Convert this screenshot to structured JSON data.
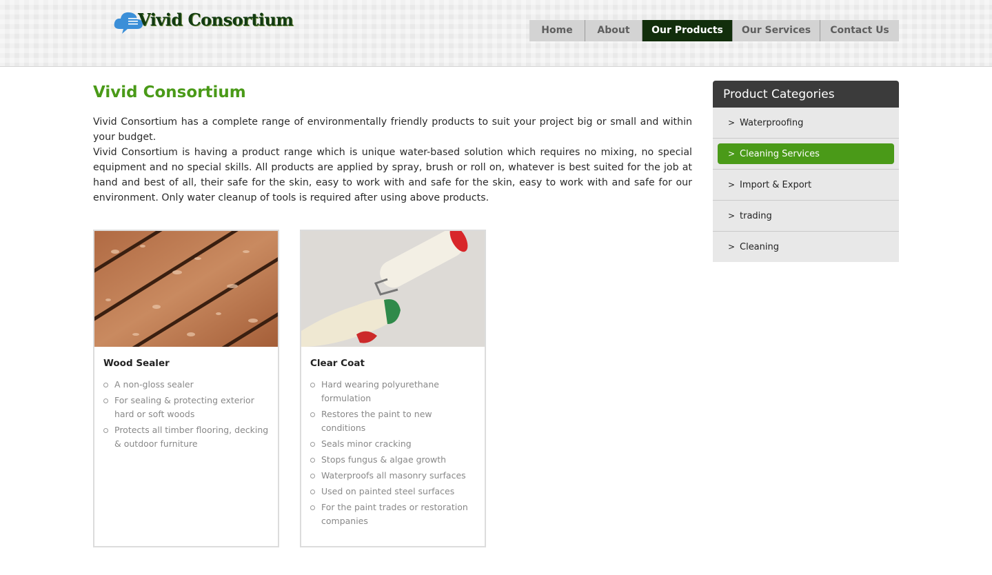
{
  "brand": {
    "name": "Vivid Consortium"
  },
  "nav": {
    "items": [
      {
        "label": "Home",
        "active": false
      },
      {
        "label": "About",
        "active": false
      },
      {
        "label": "Our Products",
        "active": true
      },
      {
        "label": "Our Services",
        "active": false
      },
      {
        "label": "Contact Us",
        "active": false
      }
    ]
  },
  "main": {
    "title": "Vivid Consortium",
    "intro_1": "Vivid Consortium has a complete range of environmentally friendly products to suit your project big or small and within your budget.",
    "intro_2": "Vivid Consortium is having a product range which is unique water-based solution which requires no mixing, no special equipment and no special skills. All products are applied by spray, brush or roll on, whatever is best suited for the job at hand and best of all, their safe for the skin, easy to work with and safe for the skin, easy to work with and safe for our environment. Only water cleanup of tools is required after using above products."
  },
  "products": [
    {
      "name": "Wood Sealer",
      "features": [
        "A non-gloss sealer",
        "For sealing & protecting exterior hard or soft woods",
        "Protects all timber flooring, decking & outdoor furniture"
      ]
    },
    {
      "name": "Clear Coat",
      "features": [
        "Hard wearing polyurethane formulation",
        "Restores the paint to new conditions",
        "Seals minor cracking",
        "Stops fungus & algae growth",
        "Waterproofs all masonry surfaces",
        "Used on painted steel surfaces",
        "For the paint trades or restoration companies"
      ]
    }
  ],
  "sidebar": {
    "title": "Product Categories",
    "chevron": ">",
    "items": [
      {
        "label": "Waterproofing",
        "active": false
      },
      {
        "label": "Cleaning Services",
        "active": true
      },
      {
        "label": "Import & Export",
        "active": false
      },
      {
        "label": "trading",
        "active": false
      },
      {
        "label": "Cleaning",
        "active": false
      }
    ]
  },
  "colors": {
    "accent_green": "#4a9a18",
    "nav_active": "#122e0c",
    "sidebar_header": "#3b3b3b"
  }
}
